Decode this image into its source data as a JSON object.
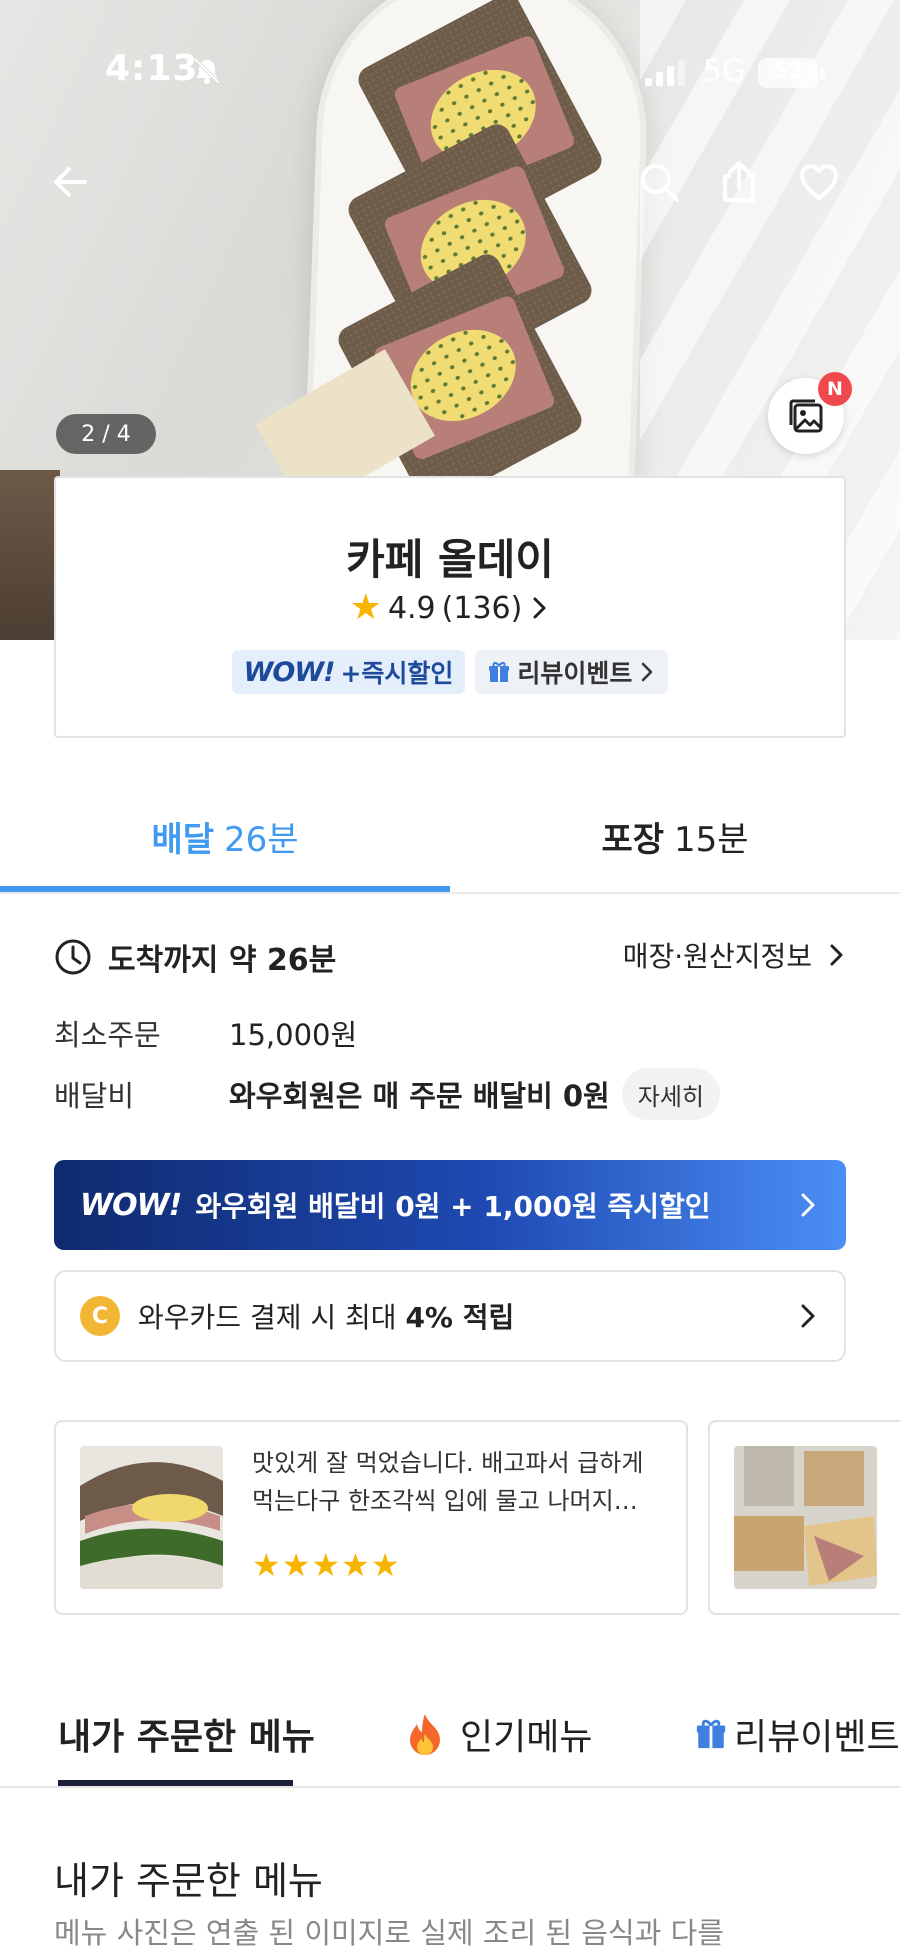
{
  "status_bar": {
    "time": "4:13",
    "network": "5G",
    "battery": "52"
  },
  "hero": {
    "pager": "2 / 4",
    "gallery_badge": "N"
  },
  "store": {
    "name": "카페 올데이",
    "rating": "4.9",
    "review_count": "(136)",
    "wow_badge_logo": "WOW!",
    "wow_badge_text": "+즉시할인",
    "event_badge": "리뷰이벤트"
  },
  "delivery_tabs": [
    {
      "label": "배달",
      "time": "26분",
      "active": true
    },
    {
      "label": "포장",
      "time": "15분",
      "active": false
    }
  ],
  "info": {
    "arrival_label": "도착까지 약 26분",
    "store_info_link": "매장·원산지정보",
    "min_order_label": "최소주문",
    "min_order_value": "15,000원",
    "delivery_fee_label": "배달비",
    "delivery_fee_value": "와우회원은 매 주문 배달비 0원",
    "detail_button": "자세히"
  },
  "wow_banner": {
    "logo": "WOW!",
    "text": "와우회원 배달비 0원 + 1,000원 즉시할인"
  },
  "card_banner": {
    "coin": "C",
    "text_prefix": "와우카드 결제 시 최대 ",
    "text_bold": "4% 적립"
  },
  "reviews": [
    {
      "line1": "맛있게 잘 먹었습니다. 배고파서 급하게",
      "line2": "먹는다구 한조각씩 입에 물고 나머지…",
      "stars": "★★★★★"
    }
  ],
  "menu_tabs": [
    {
      "label": "내가 주문한 메뉴",
      "icon": "",
      "active": true
    },
    {
      "label": "인기메뉴",
      "icon": "fire-icon",
      "active": false
    },
    {
      "label": "리뷰이벤트",
      "icon": "gift-icon",
      "active": false
    }
  ],
  "menu_section": {
    "title": "내가 주문한 메뉴",
    "subtitle": "메뉴 사진은 연출 된 이미지로 실제 조리 된 음식과 다를"
  },
  "colors": {
    "accent_blue": "#3f9af0",
    "star": "#f7b500",
    "badge_red": "#f0494d",
    "wow_navy": "#0f2a6e"
  }
}
